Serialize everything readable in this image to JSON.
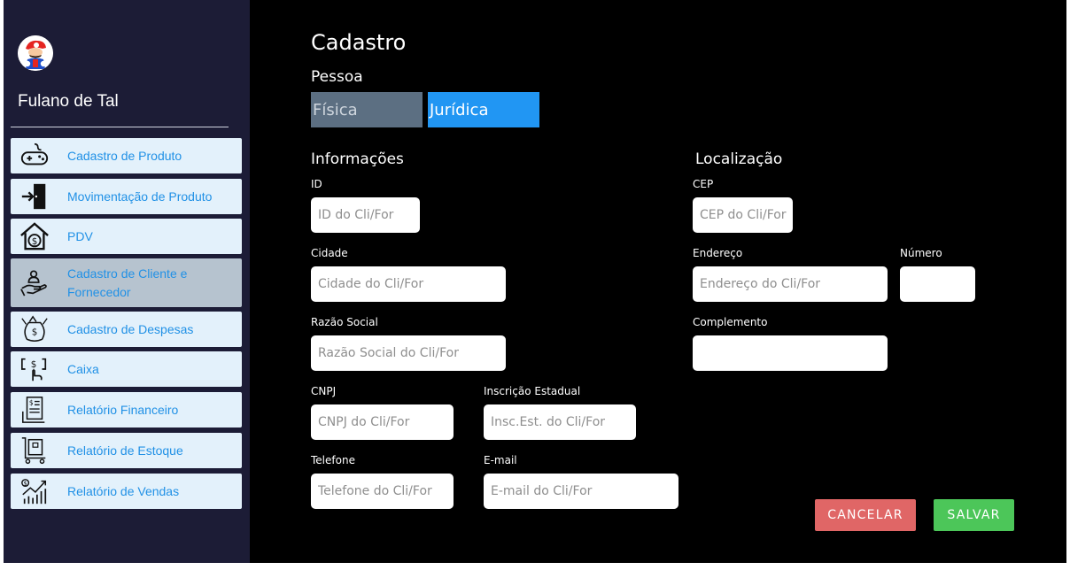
{
  "user": {
    "name": "Fulano de Tal"
  },
  "sidebar": {
    "items": [
      {
        "label": "Cadastro de Produto",
        "icon": "gamepad-icon",
        "active": false
      },
      {
        "label": "Movimentação de Produto",
        "icon": "door-enter-icon",
        "active": false
      },
      {
        "label": "PDV",
        "icon": "store-money-icon",
        "active": false
      },
      {
        "label": "Cadastro de Cliente e Fornecedor",
        "icon": "hand-person-icon",
        "active": true
      },
      {
        "label": "Cadastro de Despesas",
        "icon": "money-bag-icon",
        "active": false
      },
      {
        "label": "Caixa",
        "icon": "cash-hand-icon",
        "active": false
      },
      {
        "label": "Relatório Financeiro",
        "icon": "financial-report-icon",
        "active": false
      },
      {
        "label": "Relatório de Estoque",
        "icon": "stock-cart-icon",
        "active": false
      },
      {
        "label": "Relatório de Vendas",
        "icon": "sales-chart-icon",
        "active": false
      }
    ]
  },
  "main": {
    "title": "Cadastro",
    "pessoa": {
      "label": "Pessoa",
      "options": [
        "Física",
        "Jurídica"
      ],
      "selected": "Jurídica"
    },
    "info": {
      "title": "Informações",
      "id": {
        "label": "ID",
        "placeholder": "ID do Cli/For"
      },
      "cidade": {
        "label": "Cidade",
        "placeholder": "Cidade do Cli/For"
      },
      "razao": {
        "label": "Razão Social",
        "placeholder": "Razão Social do Cli/For"
      },
      "cnpj": {
        "label": "CNPJ",
        "placeholder": "CNPJ do Cli/For"
      },
      "ie": {
        "label": "Inscrição Estadual",
        "placeholder": "Insc.Est. do Cli/For"
      },
      "telefone": {
        "label": "Telefone",
        "placeholder": "Telefone do Cli/For"
      },
      "email": {
        "label": "E-mail",
        "placeholder": "E-mail do Cli/For"
      }
    },
    "loc": {
      "title": "Localização",
      "cep": {
        "label": "CEP",
        "placeholder": "CEP do Cli/For"
      },
      "endereco": {
        "label": "Endereço",
        "placeholder": "Endereço do Cli/For"
      },
      "numero": {
        "label": "Número",
        "placeholder": ""
      },
      "complemento": {
        "label": "Complemento",
        "placeholder": ""
      }
    },
    "buttons": {
      "cancel": "CANCELAR",
      "save": "SALVAR"
    }
  },
  "colors": {
    "sidebar_bg": "#1c1c36",
    "nav_item_bg": "#e3f1fb",
    "nav_item_active_bg": "#b6c3cf",
    "nav_text": "#2191e6",
    "segment_selected": "#2196f3",
    "segment_unselected": "#5c6f82",
    "cancel": "#e06666",
    "save": "#4cc659"
  }
}
